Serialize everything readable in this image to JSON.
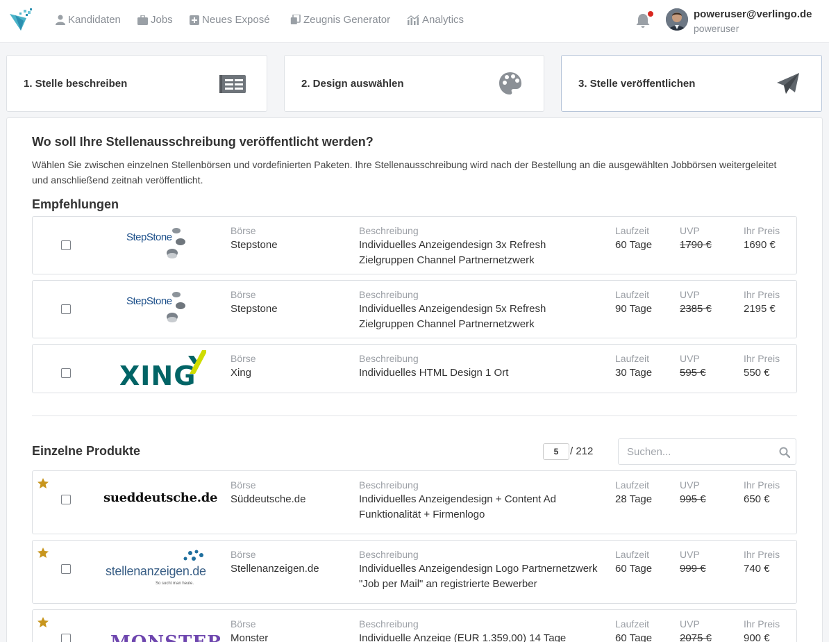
{
  "nav": {
    "items": [
      {
        "label": "Kandidaten",
        "icon": "user-icon"
      },
      {
        "label": "Jobs",
        "icon": "briefcase-icon"
      },
      {
        "label": "Neues Exposé",
        "icon": "plus-square-icon"
      },
      {
        "label": "Zeugnis Generator",
        "icon": "copy-icon"
      },
      {
        "label": "Analytics",
        "icon": "chart-icon"
      }
    ],
    "user_email": "poweruser@verlingo.de",
    "user_name": "poweruser"
  },
  "steps": [
    {
      "label": "1. Stelle beschreiben",
      "icon": "newspaper-icon"
    },
    {
      "label": "2. Design auswählen",
      "icon": "palette-icon"
    },
    {
      "label": "3. Stelle veröffentlichen",
      "icon": "paper-plane-icon"
    }
  ],
  "main": {
    "heading": "Wo soll Ihre Stellenausschreibung veröffentlicht werden?",
    "intro": "Wählen Sie zwischen einzelnen Stellenbörsen und vordefinierten Paketen. Ihre Stellenausschreibung wird nach der Bestellung an die ausgewählten Jobbörsen weitergeleitet und anschließend zeitnah veröffentlicht."
  },
  "columns": {
    "boerse": "Börse",
    "beschreibung": "Beschreibung",
    "laufzeit": "Laufzeit",
    "uvp": "UVP",
    "preis": "Ihr Preis"
  },
  "recommendations": {
    "title": "Empfehlungen",
    "items": [
      {
        "logo_text": "StepStone",
        "boerse": "Stepstone",
        "desc1": "Individuelles Anzeigendesign 3x Refresh",
        "desc2": "Zielgruppen Channel Partnernetzwerk",
        "laufzeit": "60 Tage",
        "uvp": "1790 €",
        "preis": "1690 €"
      },
      {
        "logo_text": "StepStone",
        "boerse": "Stepstone",
        "desc1": "Individuelles Anzeigendesign 5x Refresh",
        "desc2": "Zielgruppen Channel Partnernetzwerk",
        "laufzeit": "90 Tage",
        "uvp": "2385 €",
        "preis": "2195 €"
      },
      {
        "logo_text": "XING",
        "boerse": "Xing",
        "desc1": "Individuelles HTML Design 1 Ort",
        "desc2": "",
        "laufzeit": "30 Tage",
        "uvp": "595 €",
        "preis": "550 €"
      }
    ]
  },
  "products": {
    "title": "Einzelne Produkte",
    "page": "5",
    "total": "/ 212",
    "search_placeholder": "Suchen...",
    "items": [
      {
        "logo_text": "sueddeutsche.de",
        "boerse": "Süddeutsche.de",
        "desc1": "Individuelles Anzeigendesign + Content Ad",
        "desc2": "Funktionalität + Firmenlogo",
        "laufzeit": "28 Tage",
        "uvp": "995 €",
        "preis": "650 €"
      },
      {
        "logo_text": "stellenanzeigen.de",
        "logo_sub": "So sucht man heute.",
        "boerse": "Stellenanzeigen.de",
        "desc1": "Individuelles Anzeigendesign Logo Partnernetzwerk",
        "desc2": "\"Job per Mail\" an registrierte Bewerber",
        "laufzeit": "60 Tage",
        "uvp": "999 €",
        "preis": "740 €"
      },
      {
        "logo_text": "MONSTER",
        "boerse": "Monster",
        "desc1": "Individuelle Anzeige (EUR 1.359,00) 14 Tage",
        "desc2": "",
        "laufzeit": "60 Tage",
        "uvp": "2075 €",
        "preis": "900 €"
      }
    ]
  },
  "colors": {
    "star": "#c8961e",
    "xing_dark": "#026466",
    "xing_light": "#cfdc00",
    "monster": "#6e46ae",
    "stellen_blue": "#1f6f9e",
    "stellen_green": "#7fb842"
  }
}
